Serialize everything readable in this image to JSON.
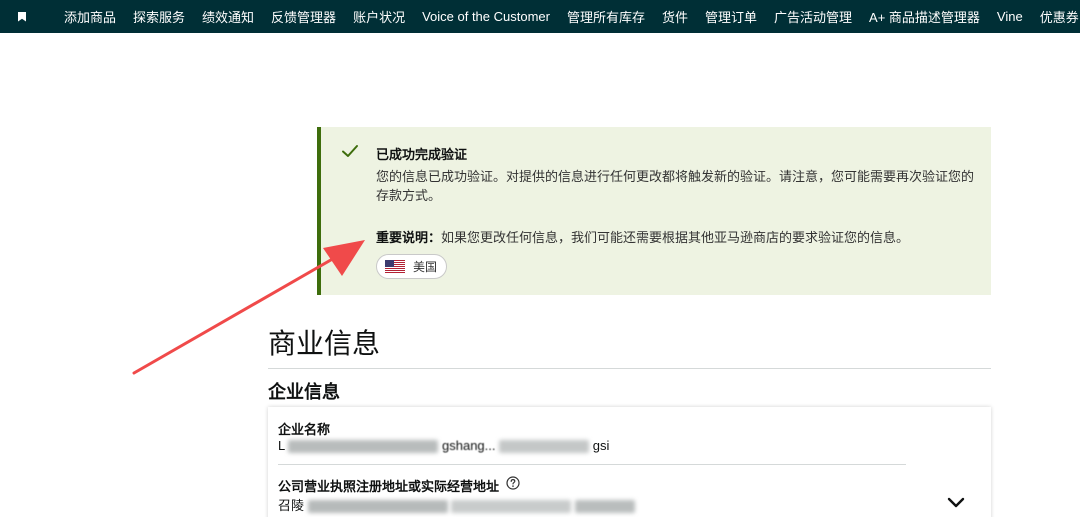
{
  "nav": {
    "items": [
      "添加商品",
      "探索服务",
      "绩效通知",
      "反馈管理器",
      "账户状况",
      "Voice of the Customer",
      "管理所有库存",
      "货件",
      "管理订单",
      "广告活动管理",
      "A+ 商品描述管理器",
      "Vine",
      "优惠券"
    ]
  },
  "alert": {
    "title": "已成功完成验证",
    "body": "您的信息已成功验证。对提供的信息进行任何更改都将触发新的验证。请注意，您可能需要再次验证您的存款方式。",
    "note_label": "重要说明：",
    "note_text": "如果您更改任何信息，我们可能还需要根据其他亚马逊商店的要求验证您的信息。",
    "country": "美国",
    "colors": {
      "background": "#eef3e2",
      "border": "#3e6d0c",
      "check": "#3e6d0c"
    }
  },
  "page": {
    "heading": "商业信息",
    "section_heading": "企业信息"
  },
  "fields": {
    "company_name_label": "企业名称",
    "company_name_visible_start": "L",
    "company_name_visible_mid": "gshang...",
    "company_name_visible_end": "gsi",
    "address_label": "公司营业执照注册地址或实际经营地址",
    "address_visible_start": "召陵"
  },
  "annotation": {
    "arrow_color": "#f04a4a"
  }
}
